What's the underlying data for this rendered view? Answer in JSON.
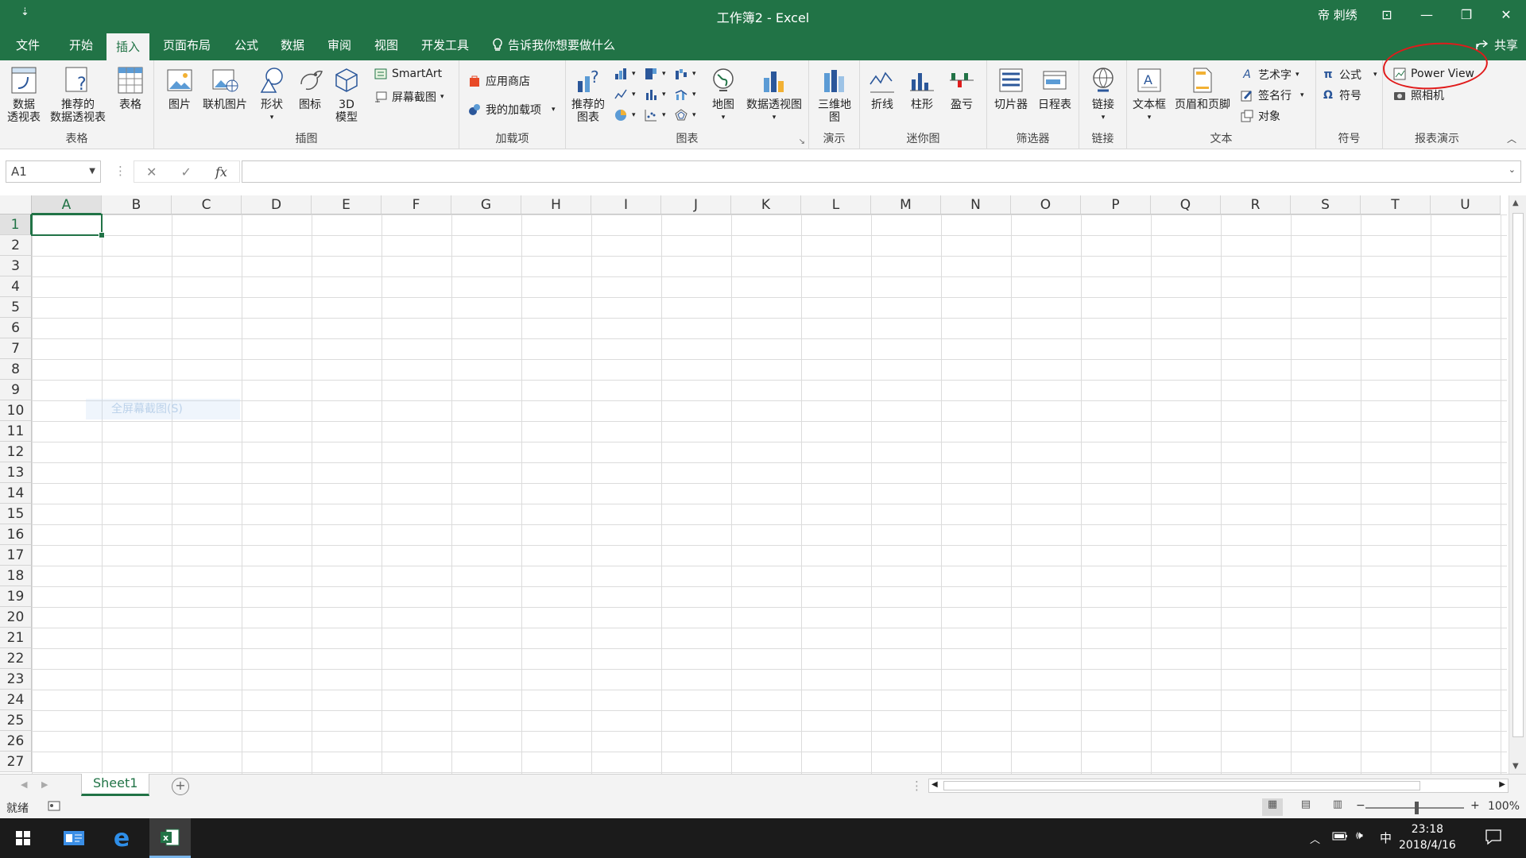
{
  "titlebar": {
    "qat": "⇣",
    "title": "工作簿2  -  Excel",
    "user": "帝 刺绣",
    "ribbon_opts": "⊡",
    "minimize": "—",
    "restore": "❐",
    "close": "✕"
  },
  "tabs": [
    "文件",
    "开始",
    "插入",
    "页面布局",
    "公式",
    "数据",
    "审阅",
    "视图",
    "开发工具"
  ],
  "tell_me": "告诉我你想要做什么",
  "share": "共享",
  "ribbon": {
    "tables": {
      "label": "表格",
      "pivot": "数据\n透视表",
      "rec_pivot": "推荐的\n数据透视表",
      "table": "表格"
    },
    "illus": {
      "label": "插图",
      "pictures": "图片",
      "online": "联机图片",
      "shapes": "形状",
      "icons": "图标",
      "model3d": "3D\n模型",
      "smartart": "SmartArt",
      "screenshot": "屏幕截图"
    },
    "addins": {
      "label": "加载项",
      "store": "应用商店",
      "my": "我的加载项"
    },
    "charts": {
      "label": "图表",
      "rec": "推荐的\n图表",
      "map": "地图",
      "pivotchart": "数据透视图"
    },
    "tours": {
      "label": "演示",
      "map3d": "三维地\n图"
    },
    "spark": {
      "label": "迷你图",
      "line": "折线",
      "column": "柱形",
      "winloss": "盈亏"
    },
    "filters": {
      "label": "筛选器",
      "slicer": "切片器",
      "timeline": "日程表"
    },
    "links": {
      "label": "链接",
      "link": "链接"
    },
    "text": {
      "label": "文本",
      "textbox": "文本框",
      "header": "页眉和页脚",
      "wordart": "艺术字",
      "sig": "签名行",
      "obj": "对象"
    },
    "symbols": {
      "label": "符号",
      "eq": "公式",
      "sym": "符号"
    },
    "reports": {
      "label": "报表演示",
      "pv": "Power View",
      "cam": "照相机"
    }
  },
  "formula": {
    "namebox": "A1",
    "fx": "fx",
    "cancel": "✕",
    "enter": "✓",
    "value": ""
  },
  "columns": [
    "A",
    "B",
    "C",
    "D",
    "E",
    "F",
    "G",
    "H",
    "I",
    "J",
    "K",
    "L",
    "M",
    "N",
    "O",
    "P",
    "Q",
    "R",
    "S",
    "T",
    "U"
  ],
  "rows": [
    "1",
    "2",
    "3",
    "4",
    "5",
    "6",
    "7",
    "8",
    "9",
    "10",
    "11",
    "12",
    "13",
    "14",
    "15",
    "16",
    "17",
    "18",
    "19",
    "20",
    "21",
    "22",
    "23",
    "24",
    "25",
    "26",
    "27"
  ],
  "ghost_tooltip": "全屏幕截图(S)",
  "sheet": {
    "name": "Sheet1",
    "add": "+"
  },
  "status": {
    "ready": "就绪",
    "zoom": "100%",
    "minus": "−",
    "plus": "+"
  },
  "taskbar": {
    "time": "23:18",
    "date": "2018/4/16",
    "ime": "中"
  },
  "colors": {
    "accent": "#217346",
    "annotation": "#e01b1b"
  }
}
